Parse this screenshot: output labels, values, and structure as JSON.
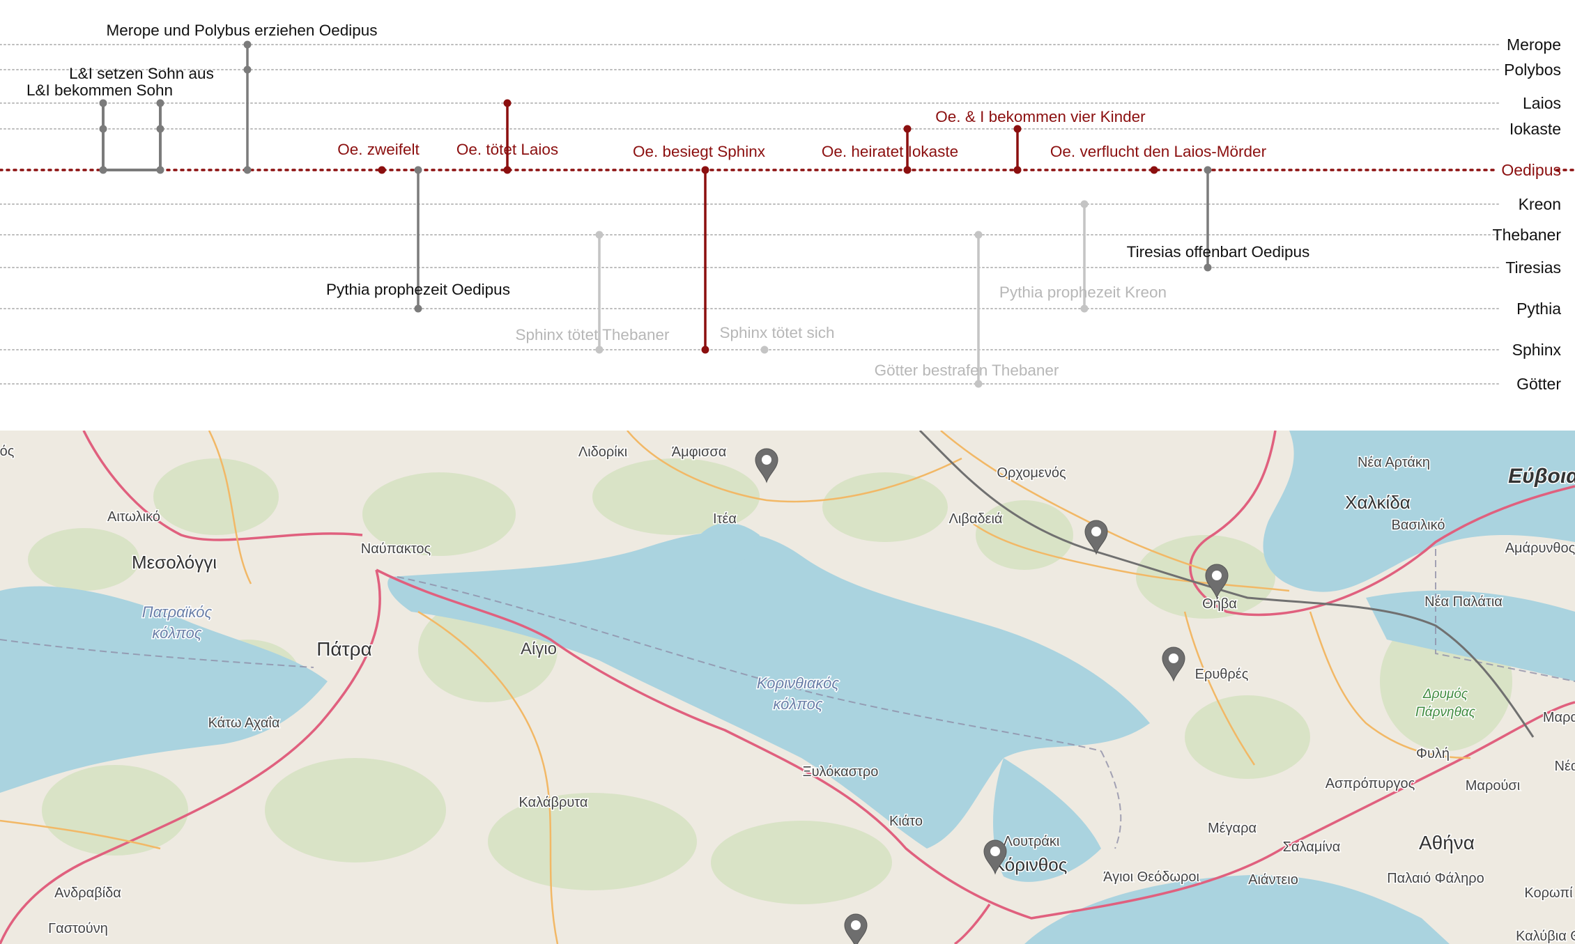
{
  "colors": {
    "protagonist": "#8b0f0f",
    "active": "#7b7b7b",
    "faded": "#c4c4c4",
    "label_active": "#111111",
    "label_faded": "#b7b7b7",
    "water": "#aad3df",
    "land": "#eeeae1",
    "forest": "#c8dcb0",
    "road_major": "#e0607e",
    "road_secondary": "#f2b866",
    "border": "#8f8fa8"
  },
  "timeline": {
    "characters": [
      {
        "id": "merope",
        "name": "Merope"
      },
      {
        "id": "polybos",
        "name": "Polybos"
      },
      {
        "id": "laios",
        "name": "Laios"
      },
      {
        "id": "iokaste",
        "name": "Iokaste"
      },
      {
        "id": "oedipus",
        "name": "Oedipus",
        "highlight": true
      },
      {
        "id": "kreon",
        "name": "Kreon"
      },
      {
        "id": "thebaner",
        "name": "Thebaner"
      },
      {
        "id": "tiresias",
        "name": "Tiresias"
      },
      {
        "id": "pythia",
        "name": "Pythia"
      },
      {
        "id": "sphinx",
        "name": "Sphinx"
      },
      {
        "id": "goetter",
        "name": "Götter"
      }
    ],
    "events": [
      {
        "id": "li-bekommen-sohn",
        "label": "L&I bekommen Sohn",
        "state": "active",
        "participants": [
          "laios",
          "iokaste",
          "oedipus"
        ]
      },
      {
        "id": "li-setzen-sohn-aus",
        "label": "L&I setzen Sohn aus",
        "state": "active",
        "participants": [
          "laios",
          "iokaste",
          "oedipus"
        ]
      },
      {
        "id": "merope-polybus",
        "label": "Merope und Polybus erziehen Oedipus",
        "state": "active",
        "participants": [
          "merope",
          "polybos",
          "oedipus"
        ]
      },
      {
        "id": "oe-zweifelt",
        "label": "Oe. zweifelt",
        "state": "protagonist",
        "participants": [
          "oedipus"
        ]
      },
      {
        "id": "pythia-prophezeit-oedipus",
        "label": "Pythia prophezeit Oedipus",
        "state": "active",
        "participants": [
          "oedipus",
          "pythia"
        ]
      },
      {
        "id": "oe-toetet-laios",
        "label": "Oe. tötet Laios",
        "state": "protagonist",
        "participants": [
          "laios",
          "oedipus"
        ]
      },
      {
        "id": "sphinx-toetet-thebaner",
        "label": "Sphinx tötet Thebaner",
        "state": "faded",
        "participants": [
          "thebaner",
          "sphinx"
        ]
      },
      {
        "id": "oe-besiegt-sphinx",
        "label": "Oe. besiegt Sphinx",
        "state": "protagonist",
        "participants": [
          "oedipus",
          "sphinx"
        ]
      },
      {
        "id": "sphinx-toetet-sich",
        "label": "Sphinx tötet sich",
        "state": "faded",
        "participants": [
          "sphinx"
        ]
      },
      {
        "id": "oe-heiratet-iokaste",
        "label": "Oe. heiratet Iokaste",
        "state": "protagonist",
        "participants": [
          "iokaste",
          "oedipus"
        ]
      },
      {
        "id": "goetter-bestrafen-thebaner",
        "label": "Götter bestrafen Thebaner",
        "state": "faded",
        "participants": [
          "thebaner",
          "goetter"
        ]
      },
      {
        "id": "oe-i-vier-kinder",
        "label": "Oe. & I bekommen vier Kinder",
        "state": "protagonist",
        "participants": [
          "iokaste",
          "oedipus"
        ]
      },
      {
        "id": "pythia-prophezeit-kreon",
        "label": "Pythia prophezeit Kreon",
        "state": "faded",
        "participants": [
          "kreon",
          "pythia"
        ]
      },
      {
        "id": "oe-verflucht",
        "label": "Oe. verflucht den Laios-Mörder",
        "state": "protagonist",
        "participants": [
          "oedipus"
        ]
      },
      {
        "id": "tiresias-offenbart",
        "label": "Tiresias offenbart Oedipus",
        "state": "active",
        "participants": [
          "oedipus",
          "tiresias"
        ]
      }
    ]
  },
  "map": {
    "places": [
      {
        "id": "lidoriki",
        "name": "Λιδορίκι"
      },
      {
        "id": "amfissa",
        "name": "Άμφισσα"
      },
      {
        "id": "orchomenos",
        "name": "Ορχομενός"
      },
      {
        "id": "nea-artaki",
        "name": "Νέα Αρτάκη"
      },
      {
        "id": "evvoia",
        "name": "Εύβοια"
      },
      {
        "id": "aitoliko",
        "name": "Αιτωλικό"
      },
      {
        "id": "itea",
        "name": "Ιτέα"
      },
      {
        "id": "livadeia",
        "name": "Λιβαδειά"
      },
      {
        "id": "chalkida",
        "name": "Χαλκίδα"
      },
      {
        "id": "vasiliko",
        "name": "Βασιλικό"
      },
      {
        "id": "amarynthos",
        "name": "Αμάρυνθος"
      },
      {
        "id": "nafpaktos",
        "name": "Ναύπακτος"
      },
      {
        "id": "mesologgi",
        "name": "Μεσολόγγι"
      },
      {
        "id": "thiva",
        "name": "Θήβα"
      },
      {
        "id": "nea-palatia",
        "name": "Νέα Παλάτια"
      },
      {
        "id": "patraikos-1",
        "name": "Πατραϊκός"
      },
      {
        "id": "patraikos-2",
        "name": "κόλπος"
      },
      {
        "id": "patra",
        "name": "Πάτρα"
      },
      {
        "id": "aigio",
        "name": "Αίγιο"
      },
      {
        "id": "korinthiakos-1",
        "name": "Κορινθιακός"
      },
      {
        "id": "korinthiakos-2",
        "name": "κόλπος"
      },
      {
        "id": "erythres",
        "name": "Ερυθρές"
      },
      {
        "id": "drymos-1",
        "name": "Δρυμός"
      },
      {
        "id": "drymos-2",
        "name": "Πάρνηθας"
      },
      {
        "id": "marathonas",
        "name": "Μαραθ"
      },
      {
        "id": "kato-achaia",
        "name": "Κάτω Αχαΐα"
      },
      {
        "id": "fyli",
        "name": "Φυλή"
      },
      {
        "id": "xylokastro",
        "name": "Ξυλόκαστρο"
      },
      {
        "id": "aspropyrgos",
        "name": "Ασπρόπυργος"
      },
      {
        "id": "marousi",
        "name": "Μαρούσι"
      },
      {
        "id": "nea-x",
        "name": "Νέα"
      },
      {
        "id": "kalavryta",
        "name": "Καλάβρυτα"
      },
      {
        "id": "kiato",
        "name": "Κιάτο"
      },
      {
        "id": "megara",
        "name": "Μέγαρα"
      },
      {
        "id": "athina",
        "name": "Αθήνα"
      },
      {
        "id": "loutraki",
        "name": "Λουτράκι"
      },
      {
        "id": "salamina",
        "name": "Σαλαμίνα"
      },
      {
        "id": "korinthos",
        "name": "Κόρινθος"
      },
      {
        "id": "agioi-theodoroi",
        "name": "Άγιοι Θεόδωροι"
      },
      {
        "id": "aianteio",
        "name": "Αιάντειο"
      },
      {
        "id": "palaio-faliro",
        "name": "Παλαιό Φάληρο"
      },
      {
        "id": "andravida",
        "name": "Ανδραβίδα"
      },
      {
        "id": "koropi",
        "name": "Κορωπί"
      },
      {
        "id": "gastouni",
        "name": "Γαστούνη"
      },
      {
        "id": "kalyvia",
        "name": "Καλύβια Θ"
      },
      {
        "id": "edge-os",
        "name": "ός"
      }
    ],
    "markers": [
      {
        "id": "marker-amfissa",
        "place": "delphi-area"
      },
      {
        "id": "marker-orchomenos",
        "place": "orchomenos-area"
      },
      {
        "id": "marker-thiva",
        "place": "thiva"
      },
      {
        "id": "marker-erythres",
        "place": "erythres"
      },
      {
        "id": "marker-korinthos",
        "place": "korinthos"
      },
      {
        "id": "marker-south",
        "place": "south"
      }
    ]
  }
}
